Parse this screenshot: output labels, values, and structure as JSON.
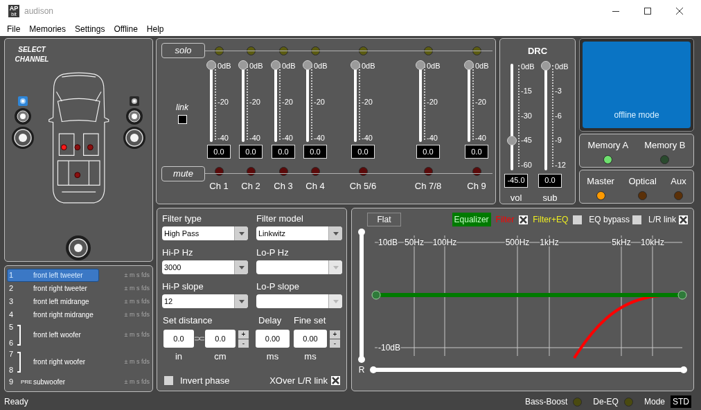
{
  "window": {
    "logo": "AP",
    "logo_sub": "bit",
    "title": "audison"
  },
  "menu": [
    {
      "label": "File"
    },
    {
      "label": "Memories"
    },
    {
      "label": "Settings"
    },
    {
      "label": "Offline"
    },
    {
      "label": "Help"
    }
  ],
  "select_channel": {
    "title": "SELECT CHANNEL",
    "left_speakers": [
      {
        "kind": "tweeter",
        "selected": true
      },
      {
        "kind": "midrange",
        "selected": false
      },
      {
        "kind": "woofer",
        "selected": false
      }
    ],
    "right_speakers": [
      {
        "kind": "tweeter",
        "selected": false
      },
      {
        "kind": "midrange",
        "selected": false
      },
      {
        "kind": "woofer",
        "selected": false
      }
    ],
    "car_dots": [
      {
        "lit": true
      },
      {
        "lit": false
      },
      {
        "lit": false
      },
      {
        "lit": false
      }
    ],
    "subwoofer": {
      "selected": false
    }
  },
  "channel_list": [
    {
      "numbers": [
        "1"
      ],
      "name": "front left tweeter",
      "flags": "± m s fds",
      "selected": true
    },
    {
      "numbers": [
        "2"
      ],
      "name": "front right tweeter",
      "flags": "± m s fds",
      "selected": false
    },
    {
      "numbers": [
        "3"
      ],
      "name": "front left midrange",
      "flags": "± m s fds",
      "selected": false
    },
    {
      "numbers": [
        "4"
      ],
      "name": "front right midrange",
      "flags": "± m s fds",
      "selected": false
    },
    {
      "numbers": [
        "5",
        "6"
      ],
      "name": "front left woofer",
      "flags": "± m s fds",
      "selected": false
    },
    {
      "numbers": [
        "7",
        "8"
      ],
      "name": "front right woofer",
      "flags": "± m s fds",
      "selected": false
    },
    {
      "numbers": [
        "9"
      ],
      "tag": "PRE",
      "name": "subwoofer",
      "flags": "± m s fds",
      "selected": false
    }
  ],
  "mixer": {
    "solo_label": "solo",
    "mute_label": "mute",
    "link": {
      "label": "link",
      "checked": false
    },
    "channels": [
      {
        "name": "Ch 1",
        "solo": false,
        "mute": false,
        "level": 1,
        "value": "0.0",
        "scale": [
          "0dB",
          "-20",
          "-40"
        ]
      },
      {
        "name": "Ch 2",
        "solo": false,
        "mute": false,
        "level": 1,
        "value": "0.0",
        "scale": [
          "0dB",
          "-20",
          "-40"
        ]
      },
      {
        "name": "Ch 3",
        "solo": false,
        "mute": false,
        "level": 1,
        "value": "0.0",
        "scale": [
          "0dB",
          "-20",
          "-40"
        ]
      },
      {
        "name": "Ch 4",
        "solo": false,
        "mute": false,
        "level": 1,
        "value": "0.0",
        "scale": [
          "0dB",
          "-20",
          "-40"
        ]
      },
      {
        "name": "Ch 5/6",
        "solo": false,
        "mute": false,
        "level": 1,
        "value": "0.0",
        "scale": [
          "0dB",
          "-20",
          "-40"
        ]
      },
      {
        "name": "Ch 7/8",
        "solo": false,
        "mute": false,
        "level": 1,
        "value": "0.0",
        "scale": [
          "0dB",
          "-20",
          "-40"
        ]
      },
      {
        "name": "Ch 9",
        "solo": false,
        "mute": false,
        "level": 1,
        "value": "0.0",
        "scale": [
          "0dB",
          "-20",
          "-40"
        ]
      }
    ]
  },
  "drc": {
    "title": "DRC",
    "sliders": [
      {
        "name": "vol",
        "level": 0.25,
        "value": "-45.0",
        "scale": [
          "0dB",
          "-15",
          "-30",
          "-45",
          "-60"
        ]
      },
      {
        "name": "sub",
        "level": 1,
        "value": "0.0",
        "scale": [
          "0dB",
          "-3",
          "-6",
          "-9",
          "-12"
        ]
      }
    ]
  },
  "display": {
    "text": "offline mode"
  },
  "memories": [
    {
      "label": "Memory A",
      "on": true
    },
    {
      "label": "Memory B",
      "on": false
    }
  ],
  "sources": [
    {
      "label": "Master",
      "on": true
    },
    {
      "label": "Optical",
      "on": false
    },
    {
      "label": "Aux",
      "on": false
    }
  ],
  "filter": {
    "dropdowns": [
      {
        "label": "Filter type",
        "value": "High Pass",
        "disabled": false
      },
      {
        "label": "Filter model",
        "value": "Linkwitz",
        "disabled": false
      },
      {
        "label": "Hi-P Hz",
        "value": "3000",
        "disabled": false
      },
      {
        "label": "Lo-P Hz",
        "disabled": true
      },
      {
        "label": "Hi-P slope",
        "value": "12",
        "disabled": false
      },
      {
        "label": "Lo-P slope",
        "disabled": true
      }
    ],
    "distance": {
      "label": "Set distance",
      "fields": [
        {
          "value": "0.0",
          "unit": "in"
        },
        {
          "value": "0.0",
          "unit": "cm"
        }
      ],
      "plus": "+",
      "minus": "-"
    },
    "delay": {
      "label": "Delay",
      "value": "0.00",
      "unit": "ms"
    },
    "fine": {
      "label": "Fine set",
      "value": "0.00",
      "unit": "ms",
      "plus": "+",
      "minus": "-"
    },
    "invert_phase": {
      "label": "Invert phase",
      "checked": false
    },
    "xover_link": {
      "label": "XOver L/R link",
      "checked": true
    }
  },
  "eq": {
    "flat": "Flat",
    "curves": [
      {
        "label": "Equalizer",
        "color": "#007a00",
        "selected": true
      },
      {
        "label": "Filter",
        "color": "#ff0000",
        "selected": false,
        "checked": true
      },
      {
        "label": "Filter+EQ",
        "color": "#f0f020",
        "selected": false,
        "checked": false
      }
    ],
    "options": [
      {
        "label": "EQ bypass",
        "checked": false
      },
      {
        "label": "L/R link",
        "checked": true
      }
    ],
    "y_labels": [
      "10dB",
      "-10dB"
    ],
    "x_labels": [
      "50Hz",
      "100Hz",
      "500Hz",
      "1kHz",
      "5kHz",
      "10kHz"
    ],
    "pan_label": "R",
    "range_slider": {
      "level": 1
    },
    "balance_slider": {
      "level": 1
    }
  },
  "status_bar": {
    "text": "Ready",
    "indicators": [
      {
        "label": "Bass-Boost",
        "on": false
      },
      {
        "label": "De-EQ",
        "on": false
      }
    ],
    "mode": {
      "label": "Mode",
      "value": "STD"
    }
  }
}
